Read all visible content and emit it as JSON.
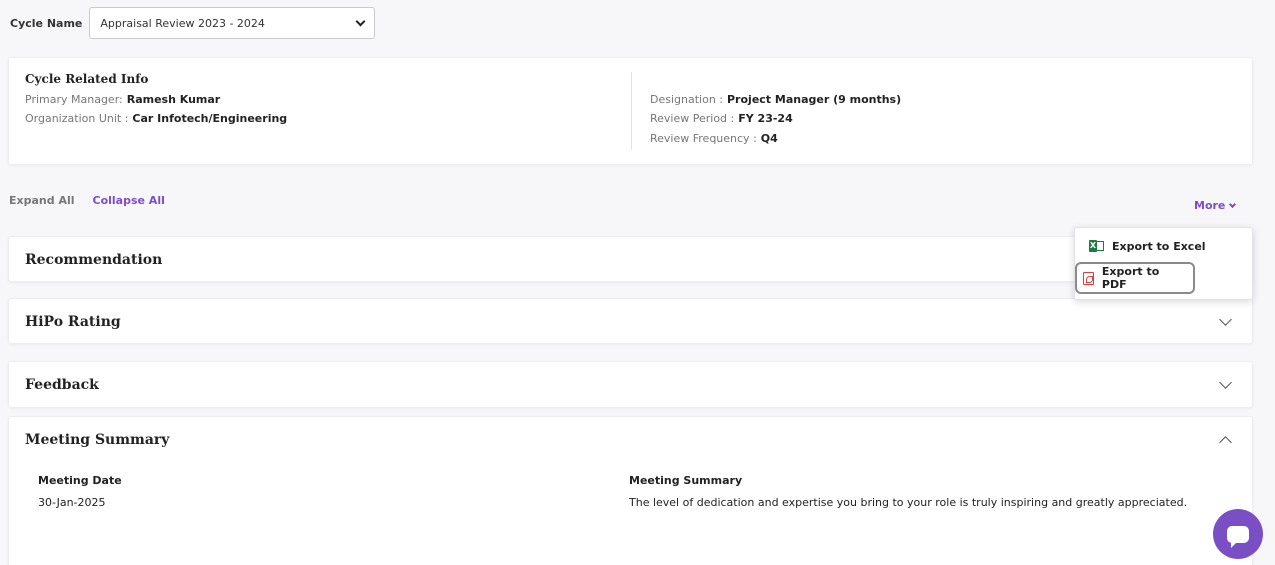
{
  "cycle": {
    "label": "Cycle Name",
    "selected": "Appraisal Review 2023 - 2024"
  },
  "info": {
    "title": "Cycle Related Info",
    "primary_manager_label": "Primary Manager:",
    "primary_manager_value": "Ramesh Kumar",
    "org_unit_label": "Organization Unit :",
    "org_unit_value": "Car Infotech/Engineering",
    "designation_label": "Designation :",
    "designation_value": "Project Manager (9 months)",
    "review_period_label": "Review Period :",
    "review_period_value": "FY 23-24",
    "review_frequency_label": "Review Frequency :",
    "review_frequency_value": "Q4"
  },
  "controls": {
    "expand_all": "Expand All",
    "collapse_all": "Collapse All",
    "more": "More"
  },
  "more_menu": {
    "export_excel": "Export to Excel",
    "export_pdf": "Export to PDF"
  },
  "sections": {
    "recommendation": "Recommendation",
    "hipo": "HiPo Rating",
    "feedback": "Feedback",
    "meeting": "Meeting Summary"
  },
  "meeting_summary": {
    "date_label": "Meeting Date",
    "date_value": "30-Jan-2025",
    "summary_label": "Meeting Summary",
    "summary_value": "The level of dedication and expertise you bring to your role is truly inspiring and greatly appreciated."
  },
  "colors": {
    "accent": "#7a4fc3",
    "excel_green": "#1d7a45",
    "pdf_red": "#d94040"
  }
}
